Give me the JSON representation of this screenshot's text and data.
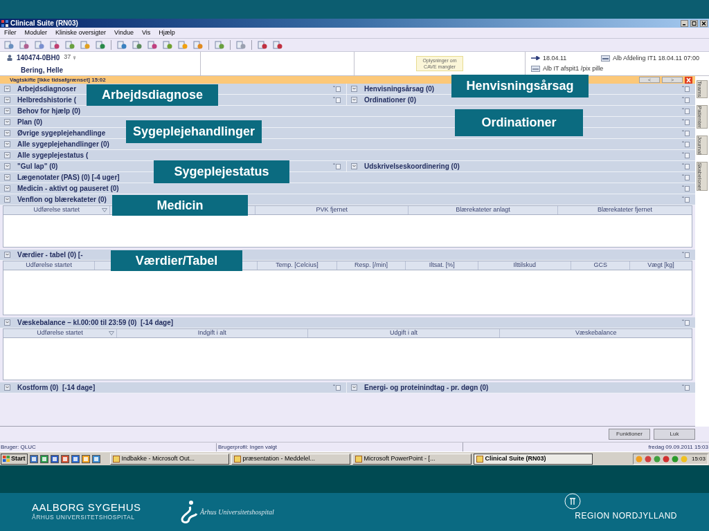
{
  "window": {
    "title": "Clinical Suite (RN03)"
  },
  "menu": [
    "Filer",
    "Moduler",
    "Kliniske oversigter",
    "Vindue",
    "Vis",
    "Hjælp"
  ],
  "patient": {
    "id": "140474-0BH0",
    "age": "37",
    "sex": "♀",
    "name": "Bering, Helle",
    "cave_note": "Oplysninger om CAVE mangler",
    "date": "18.04.11",
    "admission": "Alb Afdeling IT1 18.04.11 07:00",
    "location": "Alb IT afspit1 /pix pille"
  },
  "shift_bar": {
    "title": "Vagtskifte [Ikke tidsafgrænset] 15:02",
    "buttons": [
      "<",
      ">"
    ]
  },
  "sections": [
    {
      "kind": "pair",
      "left": "Arbejdsdiagnoser",
      "right": "Henvisningsårsag (0)"
    },
    {
      "kind": "pair",
      "left": "Helbredshistorie (",
      "right": "Ordinationer (0)"
    },
    {
      "kind": "single",
      "title": "Behov for hjælp (0)"
    },
    {
      "kind": "single",
      "title": "Plan (0)"
    },
    {
      "kind": "single",
      "title": "Øvrige sygeplejehandlinge"
    },
    {
      "kind": "single",
      "title": "Alle sygeplejehandlinger (0)"
    },
    {
      "kind": "single",
      "title": "Alle sygeplejestatus ("
    },
    {
      "kind": "pair",
      "left": "\"Gul lap\" (0)",
      "right": "Udskrivelseskoordinering (0)"
    },
    {
      "kind": "single",
      "title": "Lægenotater (PAS) (0) [-4 uger]"
    },
    {
      "kind": "single",
      "title": "Medicin - aktivt og pauseret (0)"
    },
    {
      "kind": "table",
      "title": "Venflon og blærekateter (0)",
      "columns": [
        {
          "label": "Udførelse startet",
          "sort_indicator": true
        },
        {
          "label": "PVK fjernet",
          "sort_indicator": false
        },
        {
          "label": "Blærekateter anlagt",
          "sort_indicator": false
        },
        {
          "label": "Blærekateter fjernet",
          "sort_indicator": false
        }
      ]
    },
    {
      "kind": "table",
      "title": "Værdier - tabel (0) [-",
      "columns": [
        {
          "label": "Udførelse startet",
          "sort_indicator": false
        },
        {
          "label": "Temp. [Celcius]",
          "sort_indicator": false
        },
        {
          "label": "Resp. [/min]",
          "sort_indicator": false
        },
        {
          "label": "Iltsat. [%]",
          "sort_indicator": false
        },
        {
          "label": "Ilttilskud",
          "sort_indicator": false
        },
        {
          "label": "GCS",
          "sort_indicator": false
        },
        {
          "label": "Vægt [kg]",
          "sort_indicator": false
        }
      ]
    },
    {
      "kind": "table",
      "title": "Væskebalance – kl.00:00 til 23:59 (0)  [-14 dage]",
      "columns": [
        {
          "label": "Udførelse startet",
          "sort_indicator": true
        },
        {
          "label": "Indgift i alt",
          "sort_indicator": false
        },
        {
          "label": "Udgift i alt",
          "sort_indicator": false
        },
        {
          "label": "Væskebalance",
          "sort_indicator": false
        }
      ]
    },
    {
      "kind": "pair",
      "left": "Kostform (0)  [-14 dage]",
      "right": "Energi- og proteinindtag - pr. døgn (0)"
    }
  ],
  "side_tabs": [
    "Teams",
    "Patienter",
    "Journal",
    "Skabeloner"
  ],
  "buttons": [
    "Funktioner",
    "Luk"
  ],
  "status_bar": {
    "user": "Bruger: QLUC",
    "profile": "Brugerprofil: Ingen valgt",
    "datetime": "fredag 09.09.2011 15:03"
  },
  "taskbar": {
    "start": "Start",
    "tasks": [
      {
        "label": "Indbakke - Microsoft Out...",
        "selected": false
      },
      {
        "label": "præsentation - Meddelel...",
        "selected": false
      },
      {
        "label": "Microsoft PowerPoint - [...",
        "selected": false
      },
      {
        "label": "Clinical Suite (RN03)",
        "selected": true
      }
    ],
    "clock": "15:03"
  },
  "callouts": [
    "Arbejdsdiagnose",
    "Henvisningsårsag",
    "Sygeplejehandlinger",
    "Ordinationer",
    "Sygeplejestatus",
    "Medicin",
    "Værdier/Tabel"
  ],
  "footer": {
    "left_title": "AALBORG SYGEHUS",
    "left_subtitle": "ÅRHUS UNIVERSITETSHOSPITAL",
    "center": "Århus Universitetshospital",
    "right": "REGION NORDJYLLAND"
  }
}
